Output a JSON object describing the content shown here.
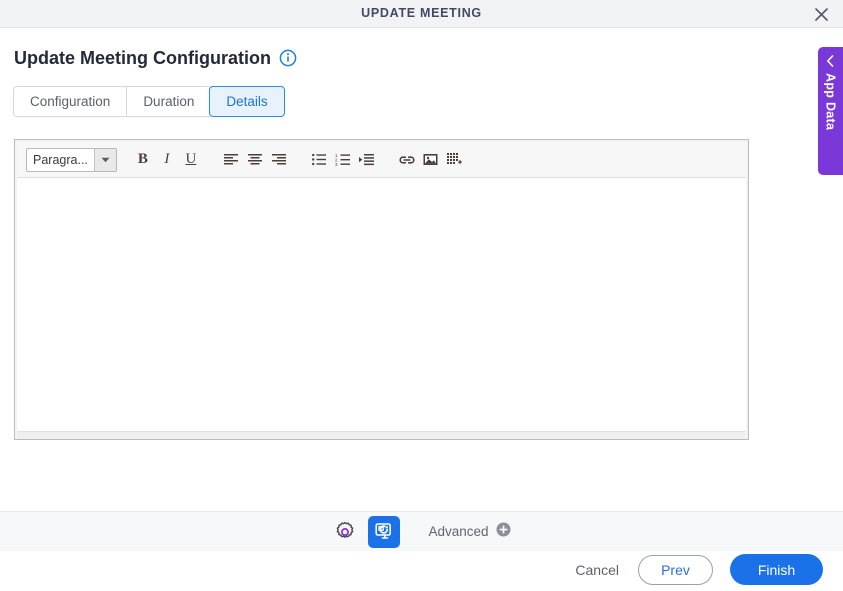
{
  "window": {
    "title": "UPDATE MEETING",
    "close_icon": "close-icon"
  },
  "page": {
    "heading": "Update Meeting Configuration",
    "info_icon": "info-icon"
  },
  "tabs": [
    {
      "label": "Configuration",
      "active": false
    },
    {
      "label": "Duration",
      "active": false
    },
    {
      "label": "Details",
      "active": true
    }
  ],
  "editor": {
    "paragraph_style": "Paragra...",
    "dropdown_icon": "chevron-down-icon",
    "content": "",
    "toolbar": [
      {
        "name": "bold-button",
        "label": "B"
      },
      {
        "name": "italic-button",
        "label": "I"
      },
      {
        "name": "underline-button",
        "label": "U"
      },
      {
        "name": "align-left-button",
        "label": ""
      },
      {
        "name": "align-center-button",
        "label": ""
      },
      {
        "name": "align-right-button",
        "label": ""
      },
      {
        "name": "bullet-list-button",
        "label": ""
      },
      {
        "name": "numbered-list-button",
        "label": ""
      },
      {
        "name": "indent-button",
        "label": ""
      },
      {
        "name": "link-button",
        "label": ""
      },
      {
        "name": "image-button",
        "label": ""
      },
      {
        "name": "table-button",
        "label": ""
      }
    ]
  },
  "footer_tools": {
    "settings_icon": "gear-icon",
    "preview_icon": "screen-refresh-icon",
    "advanced_label": "Advanced",
    "advanced_add_icon": "plus-circle-icon"
  },
  "actions": {
    "cancel": "Cancel",
    "prev": "Prev",
    "finish": "Finish"
  },
  "side_panel": {
    "label": "App Data",
    "collapse_icon": "chevron-left-icon"
  },
  "colors": {
    "accent_blue": "#1b72e8",
    "tab_active_bg": "#e8f2fd",
    "tab_active_text": "#1a73d4",
    "purple": "#7b38d8",
    "title_bar_bg": "#f2f3f5",
    "footer_bg": "#f7f8fa"
  }
}
